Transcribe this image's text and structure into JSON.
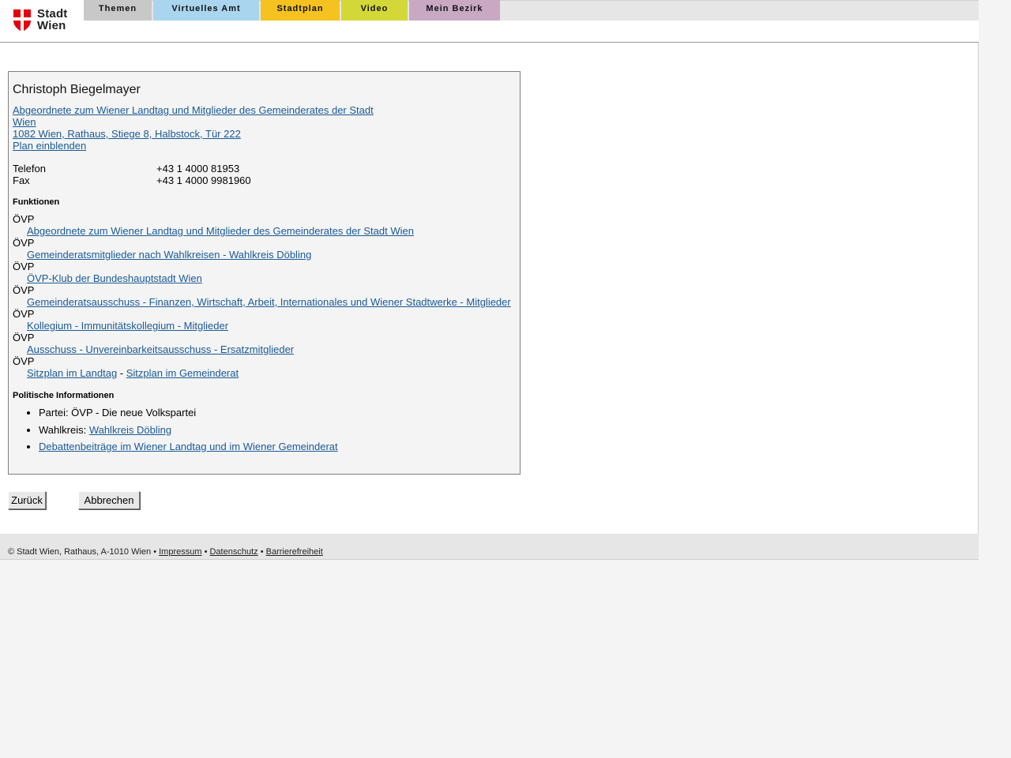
{
  "header": {
    "logo_line1": "Stadt",
    "logo_line2": "Wien",
    "nav_tabs": [
      {
        "label": "Themen",
        "color": "#c8c8c8"
      },
      {
        "label": "Virtuelles Amt",
        "color": "#a9d5ef"
      },
      {
        "label": "Stadtplan",
        "color": "#f5c220"
      },
      {
        "label": "Video",
        "color": "#d3d838"
      },
      {
        "label": "Mein Bezirk",
        "color": "#c9a8c4"
      }
    ]
  },
  "person": {
    "name": "Christoph Biegelmayer",
    "role_link": "Abgeordnete zum Wiener Landtag und Mitglieder des Gemeinderates der Stadt Wien",
    "address_link": "1082 Wien, Rathaus, Stiege 8, Halbstock, Tür 222",
    "plan_link": "Plan einblenden",
    "contact": [
      {
        "label": "Telefon",
        "value": "+43 1 4000 81953"
      },
      {
        "label": "Fax",
        "value": "+43 1 4000 9981960"
      }
    ]
  },
  "functions": {
    "heading": "Funktionen",
    "items": [
      {
        "party": "ÖVP",
        "link": "Abgeordnete zum Wiener Landtag und Mitglieder des Gemeinderates der Stadt Wien"
      },
      {
        "party": "ÖVP",
        "link": "Gemeinderatsmitglieder nach Wahlkreisen - Wahlkreis Döbling"
      },
      {
        "party": "ÖVP",
        "link": "ÖVP-Klub der Bundeshauptstadt Wien"
      },
      {
        "party": "ÖVP",
        "link": "Gemeinderatsausschuss - Finanzen, Wirtschaft, Arbeit, Internationales und Wiener Stadtwerke - Mitglieder"
      },
      {
        "party": "ÖVP",
        "link": "Kollegium - Immunitätskollegium - Mitglieder"
      },
      {
        "party": "ÖVP",
        "link": "Ausschuss - Unvereinbarkeitsausschuss - Ersatzmitglieder"
      }
    ],
    "last_party": "ÖVP",
    "seat_link_1": "Sitzplan im Landtag",
    "seat_separator": " - ",
    "seat_link_2": "Sitzplan im Gemeinderat"
  },
  "political": {
    "heading": "Politische Informationen",
    "party_text": "Partei: ÖVP - Die neue Volkspartei",
    "district_label": "Wahlkreis: ",
    "district_link": "Wahlkreis Döbling",
    "debates_link": "Debattenbeiträge im Wiener Landtag und im Wiener Gemeinderat"
  },
  "buttons": {
    "back": "Zurück",
    "cancel": "Abbrechen"
  },
  "footer": {
    "copyright": "© Stadt Wien, Rathaus, A-1010 Wien • ",
    "impressum": "Impressum",
    "sep1": " • ",
    "datenschutz": "Datenschutz",
    "sep2": " • ",
    "barrierefreiheit": "Barrierefreiheit"
  }
}
